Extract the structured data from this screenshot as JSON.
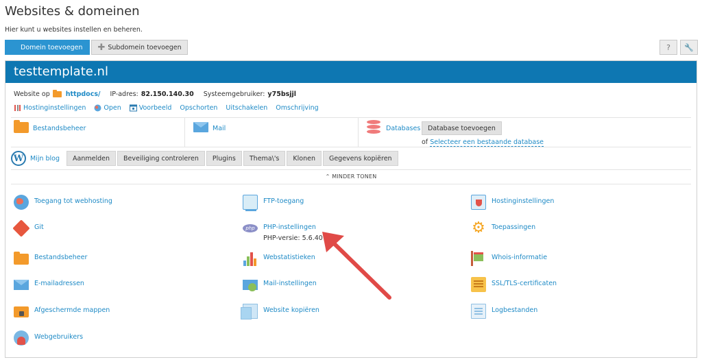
{
  "page": {
    "title": "Websites & domeinen",
    "subtitle": "Hier kunt u websites instellen en beheren."
  },
  "toolbar": {
    "add_domain": "Domein toevoegen",
    "add_subdomain": "Subdomein toevoegen",
    "help": "?"
  },
  "domain": {
    "name": "testtemplate.nl",
    "website_on_label": "Website op",
    "docroot": "httpdocs/",
    "ip_label": "IP-adres:",
    "ip": "82.150.140.30",
    "sysuser_label": "Systeemgebruiker:",
    "sysuser": "y75bsjjl"
  },
  "actions": [
    "Hostinginstellingen",
    "Open",
    "Voorbeeld",
    "Opschorten",
    "Uitschakelen",
    "Omschrijving"
  ],
  "tiles": {
    "file_manager": "Bestandsbeheer",
    "mail": "Mail",
    "databases": "Databases",
    "add_database": "Database toevoegen",
    "or": "of",
    "select_database": "Selecteer een bestaande database"
  },
  "blog": {
    "label": "Mijn blog",
    "buttons": [
      "Aanmelden",
      "Beveiliging controleren",
      "Plugins",
      "Thema\\'s",
      "Klonen",
      "Gegevens kopiëren"
    ]
  },
  "toggle": "MINDER TONEN",
  "features": {
    "col1": [
      "Toegang tot webhosting",
      "Git",
      "Bestandsbeheer",
      "E-mailadressen",
      "Afgeschermde mappen",
      "Webgebruikers"
    ],
    "col2": [
      "FTP-toegang",
      "PHP-instellingen",
      "Webstatistieken",
      "Mail-instellingen",
      "Website kopiëren"
    ],
    "col3": [
      "Hostinginstellingen",
      "Toepassingen",
      "Whois-informatie",
      "SSL/TLS-certificaten",
      "Logbestanden"
    ],
    "php_version_label": "PHP-versie:",
    "php_version": "5.6.40",
    "php_icon_text": "php"
  },
  "colors": {
    "header": "#0e77b2",
    "primary_button": "#2b94d1",
    "link": "#1e8ac6",
    "arrow": "#e04a47"
  }
}
